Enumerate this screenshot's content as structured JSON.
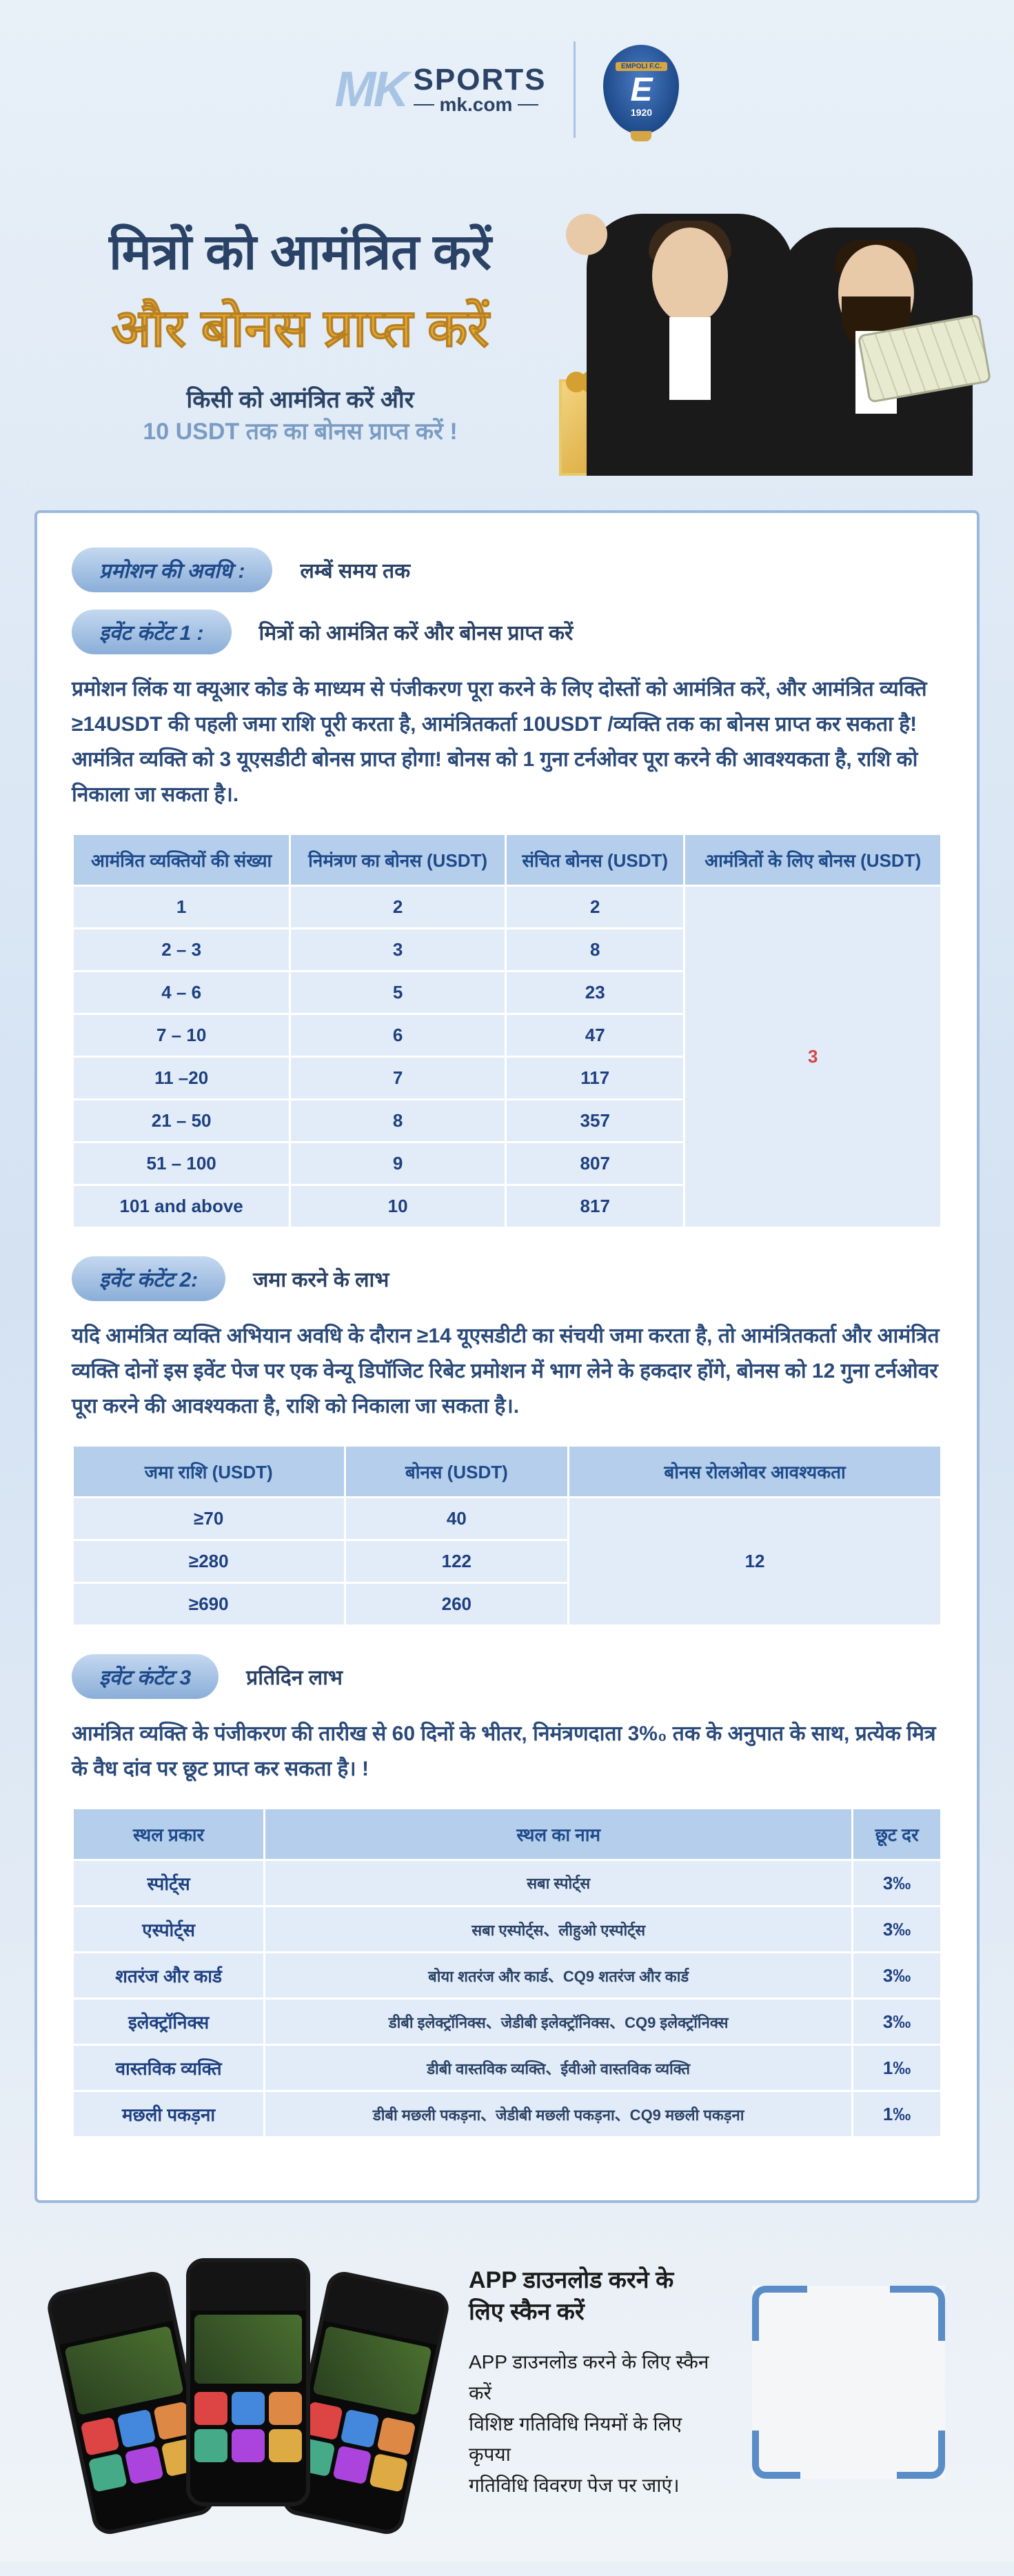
{
  "logo": {
    "mk": "MK",
    "sports": "SPORTS",
    "domain": "mk.com"
  },
  "badge": {
    "top": "EMPOLI F.C.",
    "letter": "E",
    "year": "1920"
  },
  "hero": {
    "h1": "मित्रों को आमंत्रित करें",
    "h2": "और बोनस प्राप्त करें",
    "h3": "किसी को आमंत्रित करें और",
    "h4": "10 USDT तक का बोनस प्राप्त करें !"
  },
  "sec": {
    "period_label": "प्रमोशन की अवधि :",
    "period_value": "लम्बें समय तक",
    "e1_label": "इवेंट कंटेंट 1 :",
    "e1_value": "मित्रों को आमंत्रित करें और बोनस प्राप्त करें",
    "e1_para": "प्रमोशन लिंक या क्यूआर कोड के माध्यम से पंजीकरण पूरा करने के लिए दोस्तों को आमंत्रित करें, और आमंत्रित व्यक्ति ≥14USDT की पहली जमा राशि पूरी करता है, आमंत्रितकर्ता 10USDT /व्यक्ति तक का बोनस प्राप्त कर सकता है! आमंत्रित व्यक्ति को 3 यूएसडीटी बोनस प्राप्त होगा! बोनस को 1 गुना टर्नओवर पूरा करने की आवश्यकता है, राशि को निकाला जा सकता है।.",
    "e2_label": "इवेंट कंटेंट 2:",
    "e2_value": "जमा करने के लाभ",
    "e2_para": "यदि आमंत्रित व्यक्ति अभियान अवधि के दौरान ≥14 यूएसडीटी का संचयी जमा करता है, तो आमंत्रितकर्ता और आमंत्रित व्यक्ति दोनों इस इवेंट पेज पर एक वेन्यू डिपॉजिट रिबेट प्रमोशन में भाग लेने के हकदार होंगे, बोनस को 12 गुना टर्नओवर पूरा करने की आवश्यकता है, राशि को निकाला जा सकता है।.",
    "e3_label": "इवेंट कंटेंट 3",
    "e3_value": "प्रतिदिन लाभ",
    "e3_para": "आमंत्रित व्यक्ति के पंजीकरण की तारीख से 60 दिनों के भीतर, निमंत्रणदाता 3%₀ तक के अनुपात के साथ, प्रत्येक मित्र के वैध दांव पर छूट प्राप्त कर सकता है। !"
  },
  "t1": {
    "head": [
      "आमंत्रित व्यक्तियों की संख्या",
      "निमंत्रण का बोनस (USDT)",
      "संचित बोनस (USDT)",
      "आमंत्रितों के लिए बोनस (USDT)"
    ],
    "rows": [
      [
        "1",
        "2",
        "2"
      ],
      [
        "2 – 3",
        "3",
        "8"
      ],
      [
        "4 – 6",
        "5",
        "23"
      ],
      [
        "7 – 10",
        "6",
        "47"
      ],
      [
        "11 –20",
        "7",
        "117"
      ],
      [
        "21 – 50",
        "8",
        "357"
      ],
      [
        "51 – 100",
        "9",
        "807"
      ],
      [
        "101 and above",
        "10",
        "817"
      ]
    ],
    "merged": "3"
  },
  "t2": {
    "head": [
      "जमा राशि (USDT)",
      "बोनस (USDT)",
      "बोनस रोलओवर आवश्यकता"
    ],
    "rows": [
      [
        "≥70",
        "40"
      ],
      [
        "≥280",
        "122"
      ],
      [
        "≥690",
        "260"
      ]
    ],
    "merged": "12"
  },
  "t3": {
    "head": [
      "स्थल प्रकार",
      "स्थल का नाम",
      "छूट दर"
    ],
    "rows": [
      [
        "स्पोर्ट्स",
        "सबा स्पोर्ट्स",
        "3‰"
      ],
      [
        "एस्पोर्ट्स",
        "सबा एस्पोर्ट्स、लीहुओ एस्पोर्ट्स",
        "3‰"
      ],
      [
        "शतरंज और कार्ड",
        "बोया शतरंज और कार्ड、CQ9 शतरंज और कार्ड",
        "3‰"
      ],
      [
        "इलेक्ट्रॉनिक्स",
        "डीबी इलेक्ट्रॉनिक्स、जेडीबी इलेक्ट्रॉनिक्स、CQ9 इलेक्ट्रॉनिक्स",
        "3‰"
      ],
      [
        "वास्तविक व्यक्ति",
        "डीबी वास्तविक व्यक्ति、ईवीओ वास्तविक व्यक्ति",
        "1‰"
      ],
      [
        "मछली पकड़ना",
        "डीबी मछली पकड़ना、जेडीबी मछली पकड़ना、CQ9 मछली पकड़ना",
        "1‰"
      ]
    ]
  },
  "footer": {
    "h": "APP डाउनलोड करने के लिए स्कैन करें",
    "p1": "APP डाउनलोड करने के लिए स्कैन करें",
    "p2": "विशिष्ट गतिविधि नियमों के लिए कृपया",
    "p3": "गतिविधि विवरण पेज पर जाएं।"
  }
}
